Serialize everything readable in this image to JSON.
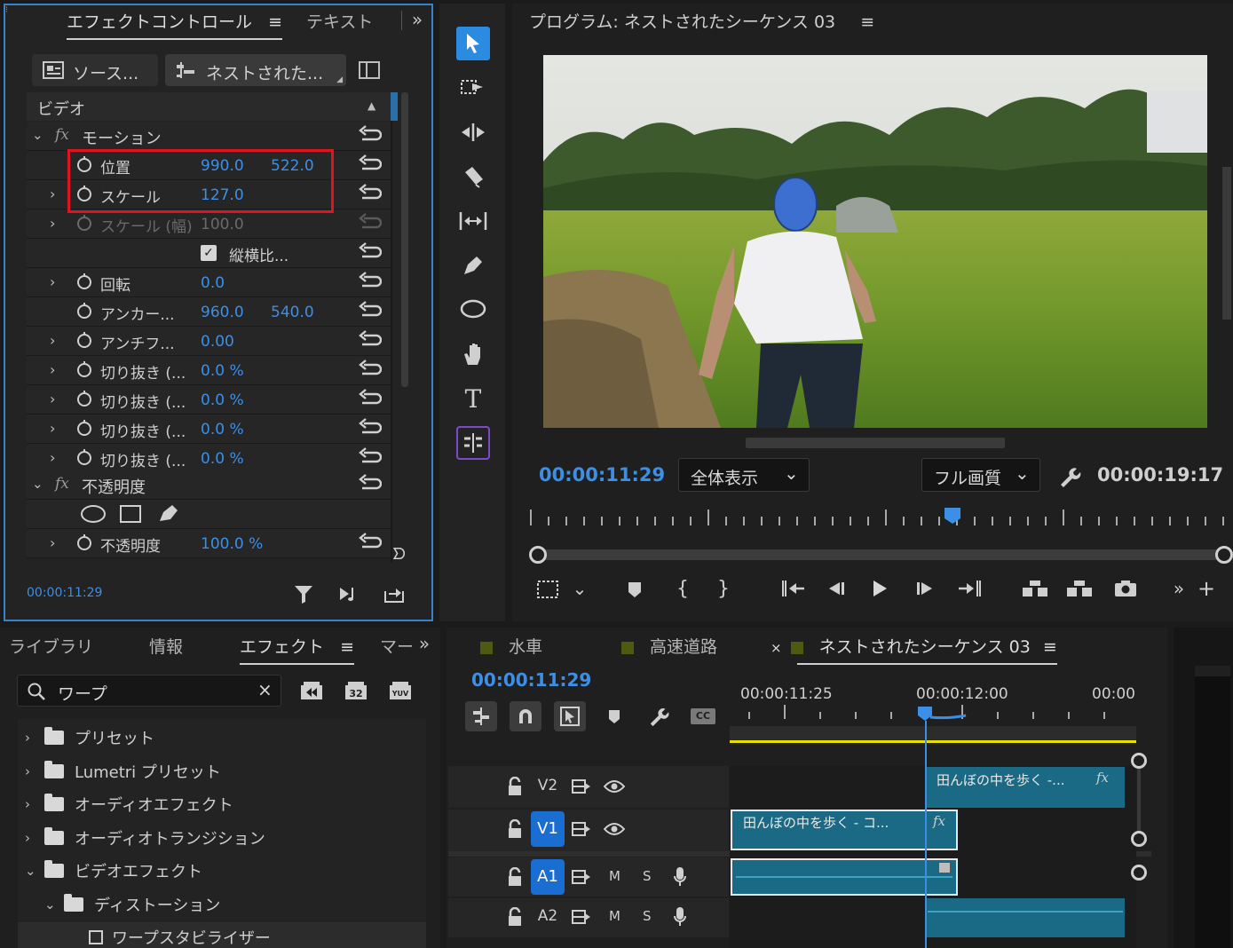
{
  "effect_controls": {
    "tabs": [
      "エフェクトコントロール",
      "テキスト"
    ],
    "source_label": "ソース...",
    "sequence_label": "ネストされた...",
    "section_video": "ビデオ",
    "motion_label": "モーション",
    "opacity_section_label": "不透明度",
    "properties": [
      {
        "name": "位置",
        "v1": "990.0",
        "v2": "522.0"
      },
      {
        "name": "スケール",
        "v1": "127.0",
        "v2": ""
      },
      {
        "name": "スケール (幅)",
        "v1": "100.0",
        "v2": ""
      },
      {
        "name": "縦横比...",
        "v1": "",
        "v2": ""
      },
      {
        "name": "回転",
        "v1": "0.0",
        "v2": ""
      },
      {
        "name": "アンカー...",
        "v1": "960.0",
        "v2": "540.0"
      },
      {
        "name": "アンチフ...",
        "v1": "0.00",
        "v2": ""
      },
      {
        "name": "切り抜き (...",
        "v1": "0.0 %",
        "v2": ""
      },
      {
        "name": "切り抜き (...",
        "v1": "0.0 %",
        "v2": ""
      },
      {
        "name": "切り抜き (...",
        "v1": "0.0 %",
        "v2": ""
      },
      {
        "name": "切り抜き (...",
        "v1": "0.0 %",
        "v2": ""
      }
    ],
    "opacity": {
      "name": "不透明度",
      "value": "100.0 %"
    },
    "timecode": "00:00:11:29"
  },
  "program": {
    "title": "プログラム: ネストされたシーケンス 03",
    "current_time": "00:00:11:29",
    "zoom_select": "全体表示",
    "quality_select": "フル画質",
    "duration": "00:00:19:17"
  },
  "bottom_left": {
    "tabs": [
      "ライブラリ",
      "情報",
      "エフェクト",
      "マー"
    ],
    "search_value": "ワープ",
    "tree": [
      {
        "label": "プリセット",
        "expanded": false,
        "indent": 0
      },
      {
        "label": "Lumetri プリセット",
        "expanded": false,
        "indent": 0
      },
      {
        "label": "オーディオエフェクト",
        "expanded": false,
        "indent": 0
      },
      {
        "label": "オーディオトランジション",
        "expanded": false,
        "indent": 0
      },
      {
        "label": "ビデオエフェクト",
        "expanded": true,
        "indent": 0
      },
      {
        "label": "ディストーション",
        "expanded": true,
        "indent": 1
      },
      {
        "label": "ワープスタビライザー",
        "expanded": false,
        "indent": 2
      }
    ]
  },
  "timeline": {
    "tabs": [
      "水車",
      "高速道路",
      "ネストされたシーケンス 03"
    ],
    "close_glyph": "×",
    "timecode": "00:00:11:29",
    "ruler": [
      "00:00:11:25",
      "00:00:12:00",
      "00:00"
    ],
    "tracks": {
      "v2": "V2",
      "v1": "V1",
      "a1": "A1",
      "a2": "A2",
      "m": "M",
      "s": "S"
    },
    "clip_v2": "田んぼの中を歩く -...",
    "clip_v1": "田んぼの中を歩く - コ...",
    "fx": "fx",
    "cc": "CC"
  },
  "colors": {
    "accent": "#3d8fe6",
    "highlight_box": "#e0141e",
    "clip": "#1a6a86",
    "work_area": "#e8e000"
  }
}
